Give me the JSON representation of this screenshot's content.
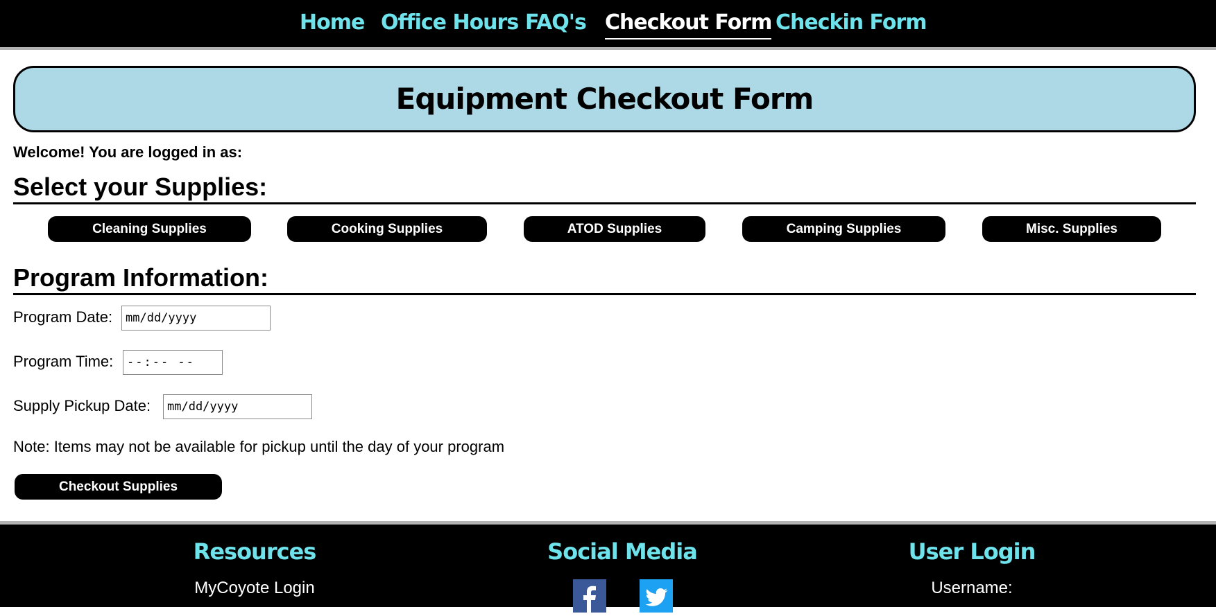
{
  "nav": {
    "items": [
      {
        "label": "Home"
      },
      {
        "label": "Office Hours"
      },
      {
        "label": "FAQ's"
      },
      {
        "label": "Checkout Form"
      },
      {
        "label": "Checkin Form"
      }
    ],
    "active": "Checkout Form",
    "link_color": "#6fe3ec"
  },
  "page_title": "Equipment Checkout Form",
  "welcome_text": "Welcome! You are logged in as:",
  "supplies": {
    "heading": "Select your Supplies:",
    "buttons": [
      {
        "label": "Cleaning Supplies"
      },
      {
        "label": "Cooking Supplies"
      },
      {
        "label": "ATOD Supplies"
      },
      {
        "label": "Camping Supplies"
      },
      {
        "label": "Misc. Supplies"
      }
    ]
  },
  "program": {
    "heading": "Program Information:",
    "date_label": "Program Date:",
    "date_value": "mm/dd/yyyy",
    "time_label": "Program Time:",
    "time_value": "--:-- --",
    "pickup_label": "Supply Pickup Date:",
    "pickup_value": "mm/dd/yyyy",
    "note": "Note: Items may not be available for pickup until the day of your program",
    "submit_label": "Checkout Supplies"
  },
  "footer": {
    "resources_heading": "Resources",
    "resources_link": "MyCoyote Login",
    "social_heading": "Social Media",
    "social_icons": [
      "facebook-icon",
      "twitter-icon"
    ],
    "login_heading": "User Login",
    "username_label": "Username:"
  },
  "colors": {
    "banner_bg": "#add8e6",
    "accent": "#6fe3ec",
    "facebook": "#3b5998",
    "twitter": "#1da1f2"
  }
}
